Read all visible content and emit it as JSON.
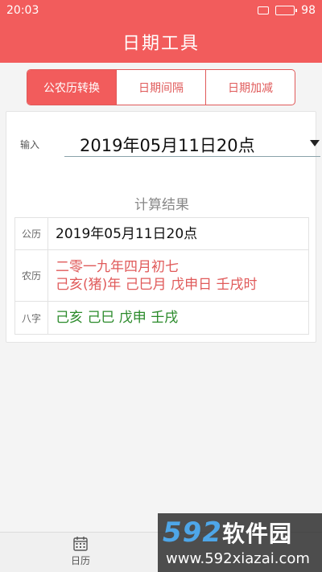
{
  "status_bar": {
    "time": "20:03",
    "battery_text": "98",
    "battery_level": 0.98
  },
  "app_bar": {
    "title": "日期工具"
  },
  "tabs": [
    {
      "label": "公农历转换",
      "active": true
    },
    {
      "label": "日期间隔",
      "active": false
    },
    {
      "label": "日期加减",
      "active": false
    }
  ],
  "input": {
    "label": "输入",
    "value": "2019年05月11日20点"
  },
  "result": {
    "title": "计算结果",
    "rows": [
      {
        "label": "公历",
        "lines": [
          "2019年05月11日20点"
        ]
      },
      {
        "label": "农历",
        "lines": [
          "二零一九年四月初七",
          "己亥(猪)年 己巳月 戊申日 壬戌时"
        ]
      },
      {
        "label": "八字",
        "lines": [
          "己亥 己巳 戊申 壬戌"
        ]
      }
    ]
  },
  "bottom_nav": {
    "items": [
      {
        "label": "日历",
        "icon": "calendar-icon"
      }
    ]
  },
  "watermark": {
    "brand_num": "592",
    "brand_cn": "软件园",
    "url": "www.592xiazai.com"
  },
  "colors": {
    "primary": "#f25c5c",
    "lunar_text": "#e05a5a",
    "bazi_text": "#2a8a2a"
  }
}
